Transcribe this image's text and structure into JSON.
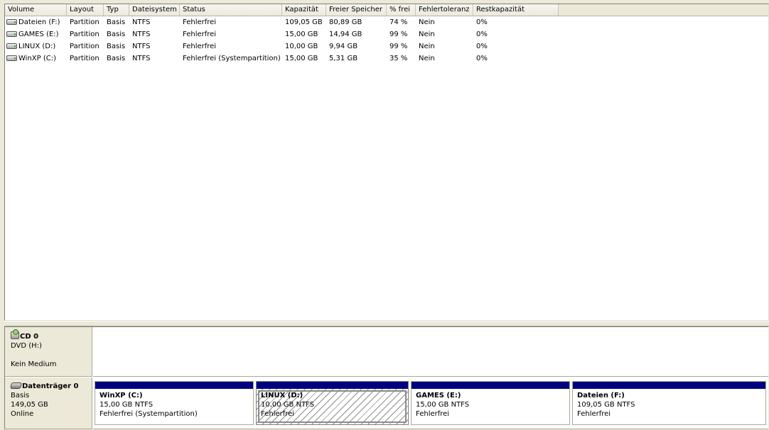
{
  "volume_list": {
    "columns": [
      "Volume",
      "Layout",
      "Typ",
      "Dateisystem",
      "Status",
      "Kapazität",
      "Freier Speicher",
      "% frei",
      "Fehlertoleranz",
      "Restkapazität"
    ],
    "rows": [
      {
        "volume": "Dateien (F:)",
        "layout": "Partition",
        "typ": "Basis",
        "dateisystem": "NTFS",
        "status": "Fehlerfrei",
        "kapazitaet": "109,05 GB",
        "frei": "80,89 GB",
        "prozent": "74 %",
        "fehlertoleranz": "Nein",
        "rest": "0%"
      },
      {
        "volume": "GAMES (E:)",
        "layout": "Partition",
        "typ": "Basis",
        "dateisystem": "NTFS",
        "status": "Fehlerfrei",
        "kapazitaet": "15,00 GB",
        "frei": "14,94 GB",
        "prozent": "99 %",
        "fehlertoleranz": "Nein",
        "rest": "0%"
      },
      {
        "volume": "LINUX (D:)",
        "layout": "Partition",
        "typ": "Basis",
        "dateisystem": "NTFS",
        "status": "Fehlerfrei",
        "kapazitaet": "10,00 GB",
        "frei": "9,94 GB",
        "prozent": "99 %",
        "fehlertoleranz": "Nein",
        "rest": "0%"
      },
      {
        "volume": "WinXP (C:)",
        "layout": "Partition",
        "typ": "Basis",
        "dateisystem": "NTFS",
        "status": "Fehlerfrei (Systempartition)",
        "kapazitaet": "15,00 GB",
        "frei": "5,31 GB",
        "prozent": "35 %",
        "fehlertoleranz": "Nein",
        "rest": "0%"
      }
    ]
  },
  "cd": {
    "title": "CD 0",
    "type": "DVD (H:)",
    "status": "Kein Medium"
  },
  "disk0": {
    "title": "Datenträger 0",
    "type": "Basis",
    "size": "149,05 GB",
    "status": "Online",
    "partitions": [
      {
        "name": "WinXP  (C:)",
        "size": "15,00 GB NTFS",
        "status": "Fehlerfrei (Systempartition)"
      },
      {
        "name": "LINUX  (D:)",
        "size": "10,00 GB NTFS",
        "status": "Fehlerfrei"
      },
      {
        "name": "GAMES  (E:)",
        "size": "15,00 GB NTFS",
        "status": "Fehlerfrei"
      },
      {
        "name": "Dateien  (F:)",
        "size": "109,05 GB NTFS",
        "status": "Fehlerfrei"
      }
    ]
  },
  "colors": {
    "partition_bar": "#00007f",
    "window_bg": "#ece9d8"
  }
}
